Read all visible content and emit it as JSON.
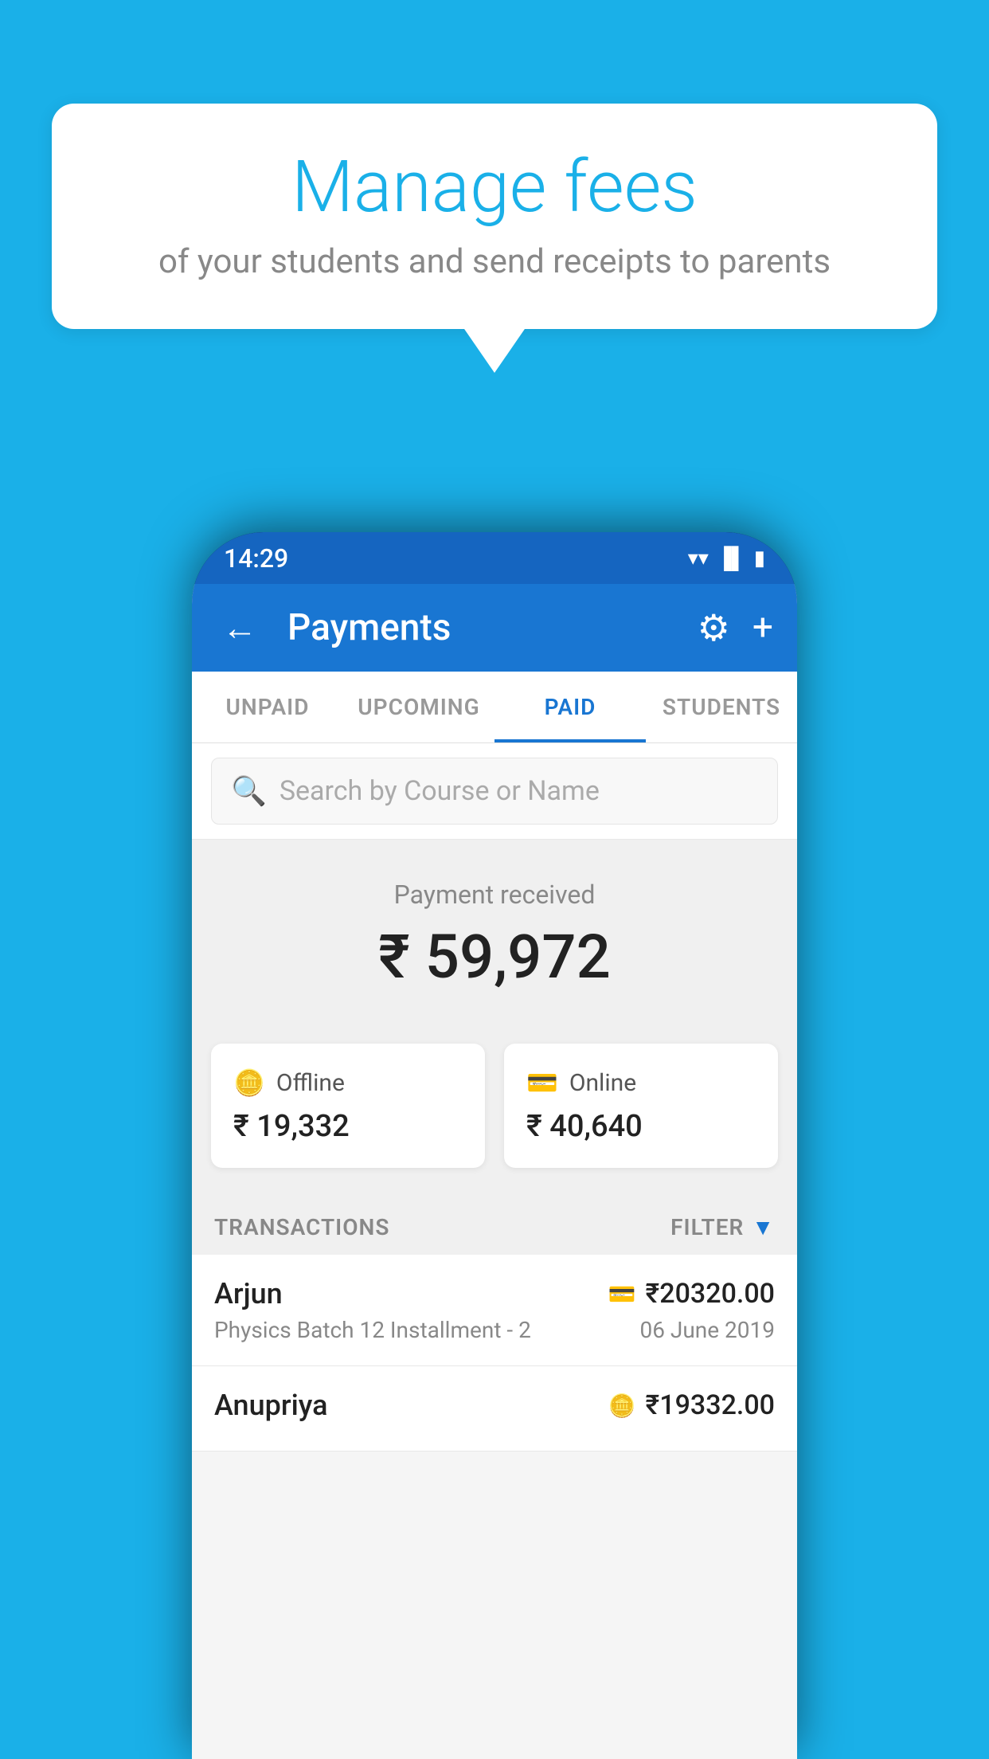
{
  "background_color": "#1ab0e8",
  "speech_bubble": {
    "title": "Manage fees",
    "subtitle": "of your students and send receipts to parents"
  },
  "status_bar": {
    "time": "14:29",
    "icons": [
      "wifi",
      "signal",
      "battery"
    ]
  },
  "app_bar": {
    "title": "Payments",
    "back_label": "←",
    "gear_label": "⚙",
    "plus_label": "+"
  },
  "tabs": [
    {
      "label": "UNPAID",
      "active": false
    },
    {
      "label": "UPCOMING",
      "active": false
    },
    {
      "label": "PAID",
      "active": true
    },
    {
      "label": "STUDENTS",
      "active": false
    }
  ],
  "search": {
    "placeholder": "Search by Course or Name"
  },
  "payment_received": {
    "label": "Payment received",
    "amount": "₹ 59,972"
  },
  "cards": [
    {
      "icon": "📋",
      "label": "Offline",
      "amount": "₹ 19,332"
    },
    {
      "icon": "💳",
      "label": "Online",
      "amount": "₹ 40,640"
    }
  ],
  "transactions_section": {
    "label": "TRANSACTIONS",
    "filter_label": "FILTER"
  },
  "transactions": [
    {
      "name": "Arjun",
      "course": "Physics Batch 12 Installment - 2",
      "amount": "₹20320.00",
      "date": "06 June 2019",
      "payment_type": "online"
    },
    {
      "name": "Anupriya",
      "course": "",
      "amount": "₹19332.00",
      "date": "",
      "payment_type": "offline"
    }
  ]
}
